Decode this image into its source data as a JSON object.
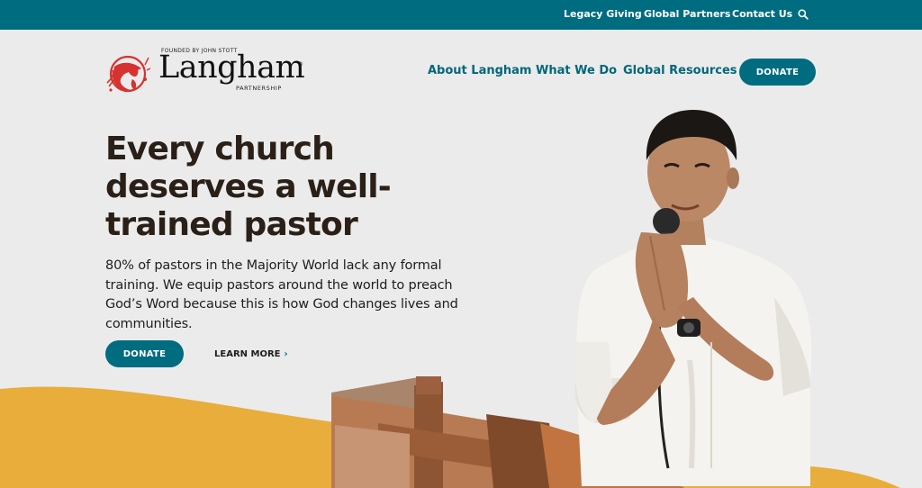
{
  "topbar": {
    "links": [
      "Legacy Giving",
      "Global Partners",
      "Contact Us"
    ],
    "search_icon": "search-icon"
  },
  "logo": {
    "founded": "FOUNDED BY JOHN STOTT",
    "name": "Langham",
    "reg": "®",
    "partnership": "PARTNERSHIP",
    "icon": "globe-icon"
  },
  "nav": {
    "items": [
      "About Langham",
      "What We Do",
      "Global Resources"
    ],
    "donate": "DONATE"
  },
  "hero": {
    "headline": "Every church deserves a well-trained pastor",
    "subtext": "80% of pastors in the Majority World lack any formal training. We equip pastors around the world to preach God’s Word because this is how God changes lives and communities.",
    "donate": "DONATE",
    "learn_more": "LEARN MORE",
    "chevron_icon": "chevron-right-icon"
  },
  "colors": {
    "primary": "#006c80",
    "accent": "#e9ad3c",
    "background": "#ebebeb",
    "logo_red": "#d6322f"
  }
}
